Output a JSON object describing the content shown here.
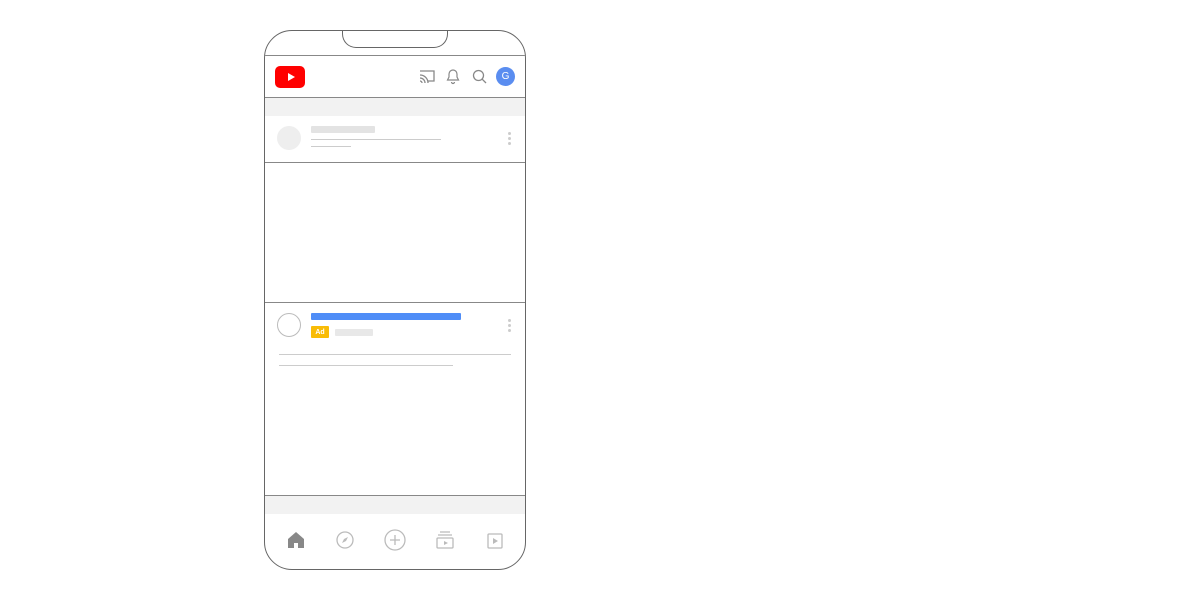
{
  "header": {
    "avatar_letter": "G"
  },
  "feed": {
    "item_title_placeholder": "",
    "ad_badge_label": "Ad"
  },
  "colors": {
    "brand_red": "#ff0000",
    "accent_blue": "#4f8df7",
    "avatar_blue": "#5a8df0",
    "ad_yellow": "#f9bc06"
  }
}
